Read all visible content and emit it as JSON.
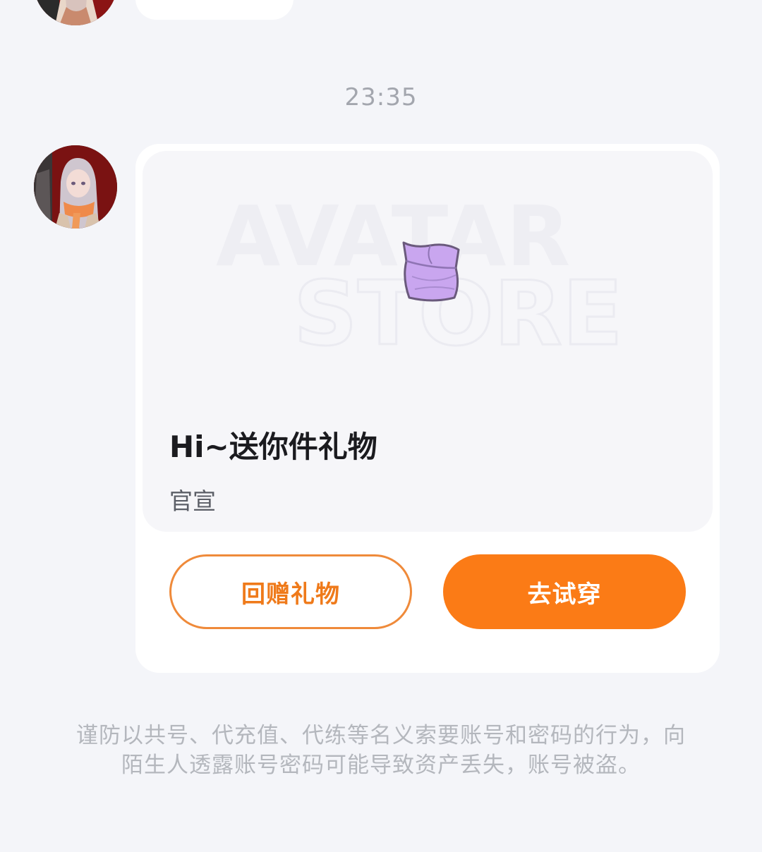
{
  "chat": {
    "timestamp": "23:35",
    "gift_card": {
      "preview_watermark_line1": "AVATAR",
      "preview_watermark_line2": "STORE",
      "title": "Hi~送你件礼物",
      "sender": "官宣",
      "return_gift_label": "回赠礼物",
      "try_on_label": "去试穿"
    },
    "security_notice": "谨防以共号、代充值、代练等名义索要账号和密码的行为，向陌生人透露账号密码可能导致资产丢失，账号被盗。"
  },
  "colors": {
    "background": "#f4f5f9",
    "card": "#ffffff",
    "accent_orange": "#fb7b16",
    "outline_orange": "#ef8a3a",
    "gift_purple": "#c9a6ef"
  },
  "icons": {
    "avatar": "anime-girl-avatar",
    "gift_item": "purple-tube-top"
  }
}
